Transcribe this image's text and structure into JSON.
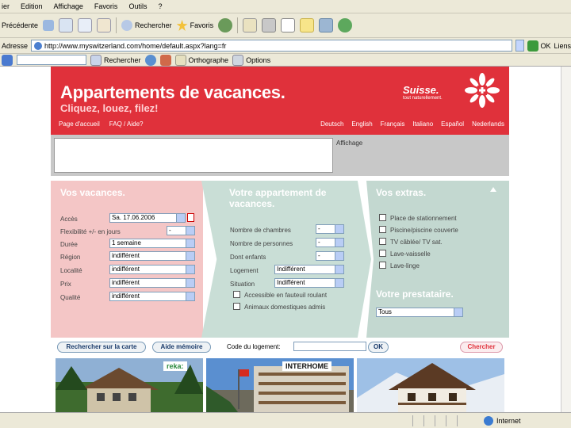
{
  "menubar": {
    "items": [
      "ier",
      "Edition",
      "Affichage",
      "Favoris",
      "Outils",
      "?"
    ]
  },
  "toolbar": {
    "back_label": "Précédente",
    "search_label": "Rechercher",
    "favorites_label": "Favoris"
  },
  "address": {
    "label": "Adresse",
    "url": "http://www.myswitzerland.com/home/default.aspx?lang=fr",
    "go_label": "OK",
    "links_label": "Liens"
  },
  "googlebar": {
    "search_label": "Rechercher",
    "spell_label": "Orthographe",
    "options_label": "Options"
  },
  "site": {
    "title": "Appartements de vacances.",
    "subtitle": "Cliquez, louez, filez!",
    "brand": "Suisse.",
    "brand_tag": "tout naturellement.",
    "nav": [
      "Page d'accueil",
      "FAQ / Aide?"
    ],
    "languages": [
      "Deutsch",
      "English",
      "Français",
      "Italiano",
      "Español",
      "Nederlands"
    ],
    "banner_label": "Affichage"
  },
  "vacances": {
    "heading": "Vos vacances.",
    "fields": [
      {
        "label": "Accès",
        "value": "Sa. 17.06.2006"
      },
      {
        "label": "Flexibilité +/- en jours",
        "value": "-"
      },
      {
        "label": "Durée",
        "value": "1 semaine"
      },
      {
        "label": "Région",
        "value": "indifférent"
      },
      {
        "label": "Localité",
        "value": "indifférent"
      },
      {
        "label": "Prix",
        "value": "indifférent"
      },
      {
        "label": "Qualité",
        "value": "indifférent"
      }
    ]
  },
  "appartement": {
    "heading": "Votre appartement de vacances.",
    "fields": [
      {
        "label": "Nombre de chambres",
        "value": "-"
      },
      {
        "label": "Nombre de personnes",
        "value": "-"
      },
      {
        "label": "Dont enfants",
        "value": "-"
      },
      {
        "label": "Logement",
        "value": "Indifférent"
      },
      {
        "label": "Situation",
        "value": "Indifférent"
      }
    ],
    "checks": [
      "Accessible en fauteuil roulant",
      "Animaux domestiques admis"
    ]
  },
  "extras": {
    "heading": "Vos extras.",
    "checks": [
      "Place de stationnement",
      "Piscine/piscine couverte",
      "TV câblée/ TV sat.",
      "Lave-vaisselle",
      "Lave-linge"
    ]
  },
  "prestataire": {
    "heading": "Votre prestataire.",
    "value": "Tous"
  },
  "search": {
    "map_button": "Rechercher sur la carte",
    "memo_button": "Aide mémoire",
    "code_label": "Code du logement:",
    "ok_button": "OK",
    "search_button": "Chercher"
  },
  "photos": {
    "logos": [
      "reka:",
      "INTERHOME"
    ]
  },
  "status": {
    "zone": "Internet"
  }
}
